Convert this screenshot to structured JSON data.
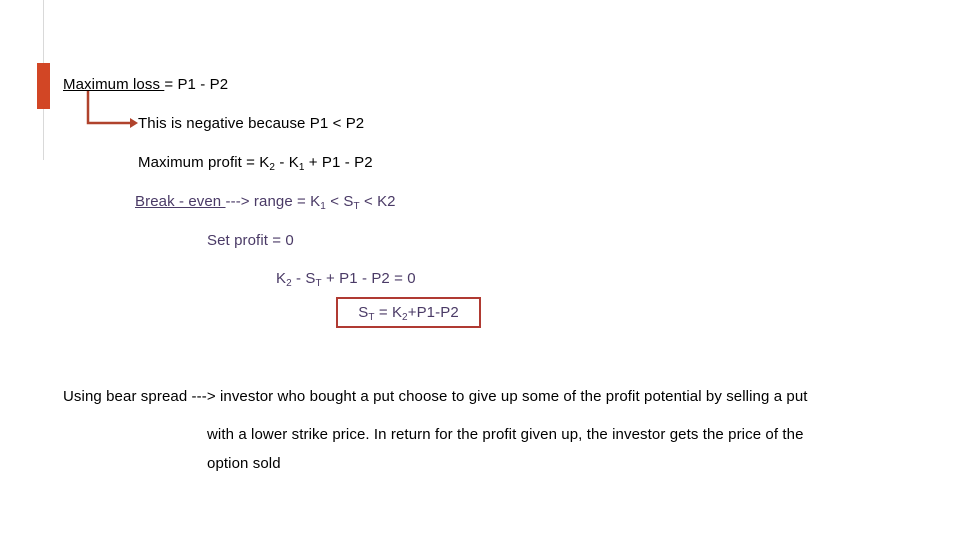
{
  "slide": {
    "accent_color": "#d24625",
    "rule_color": "#d9d9d9",
    "purple_color": "#4a3a66",
    "box_border_color": "#b03a32",
    "arrow_color": "#b0432c"
  },
  "content": {
    "max_loss": {
      "underlined": "Maximum loss ",
      "rest": "= P1 - P2"
    },
    "negative_note": "This is negative because P1 < P2",
    "max_profit": {
      "prefix": "Maximum profit = K",
      "sub1": "2",
      "mid1": " - K",
      "sub2": "1",
      "suffix": " + P1 - P2"
    },
    "break_even": {
      "underlined": "Break - even ",
      "mid": "---> range = K",
      "sub1": "1",
      "mid2": " < S",
      "sub2": "T",
      "suffix": " < K2"
    },
    "set_profit": "Set profit = 0",
    "equation": {
      "prefix": "K",
      "sub1": "2",
      "mid1": " - S",
      "sub2": "T",
      "suffix": " + P1 - P2 = 0"
    },
    "result": {
      "prefix": "S",
      "sub1": "T",
      "mid1": " = K",
      "sub2": "2",
      "suffix": "+P1-P2"
    },
    "paragraph": {
      "line1": "Using bear spread ---> investor who bought a put choose to give up some of the profit potential by selling a put",
      "line2": "with a lower strike price. In return for the profit given up, the investor  gets the price of the",
      "line3": "option sold"
    }
  }
}
